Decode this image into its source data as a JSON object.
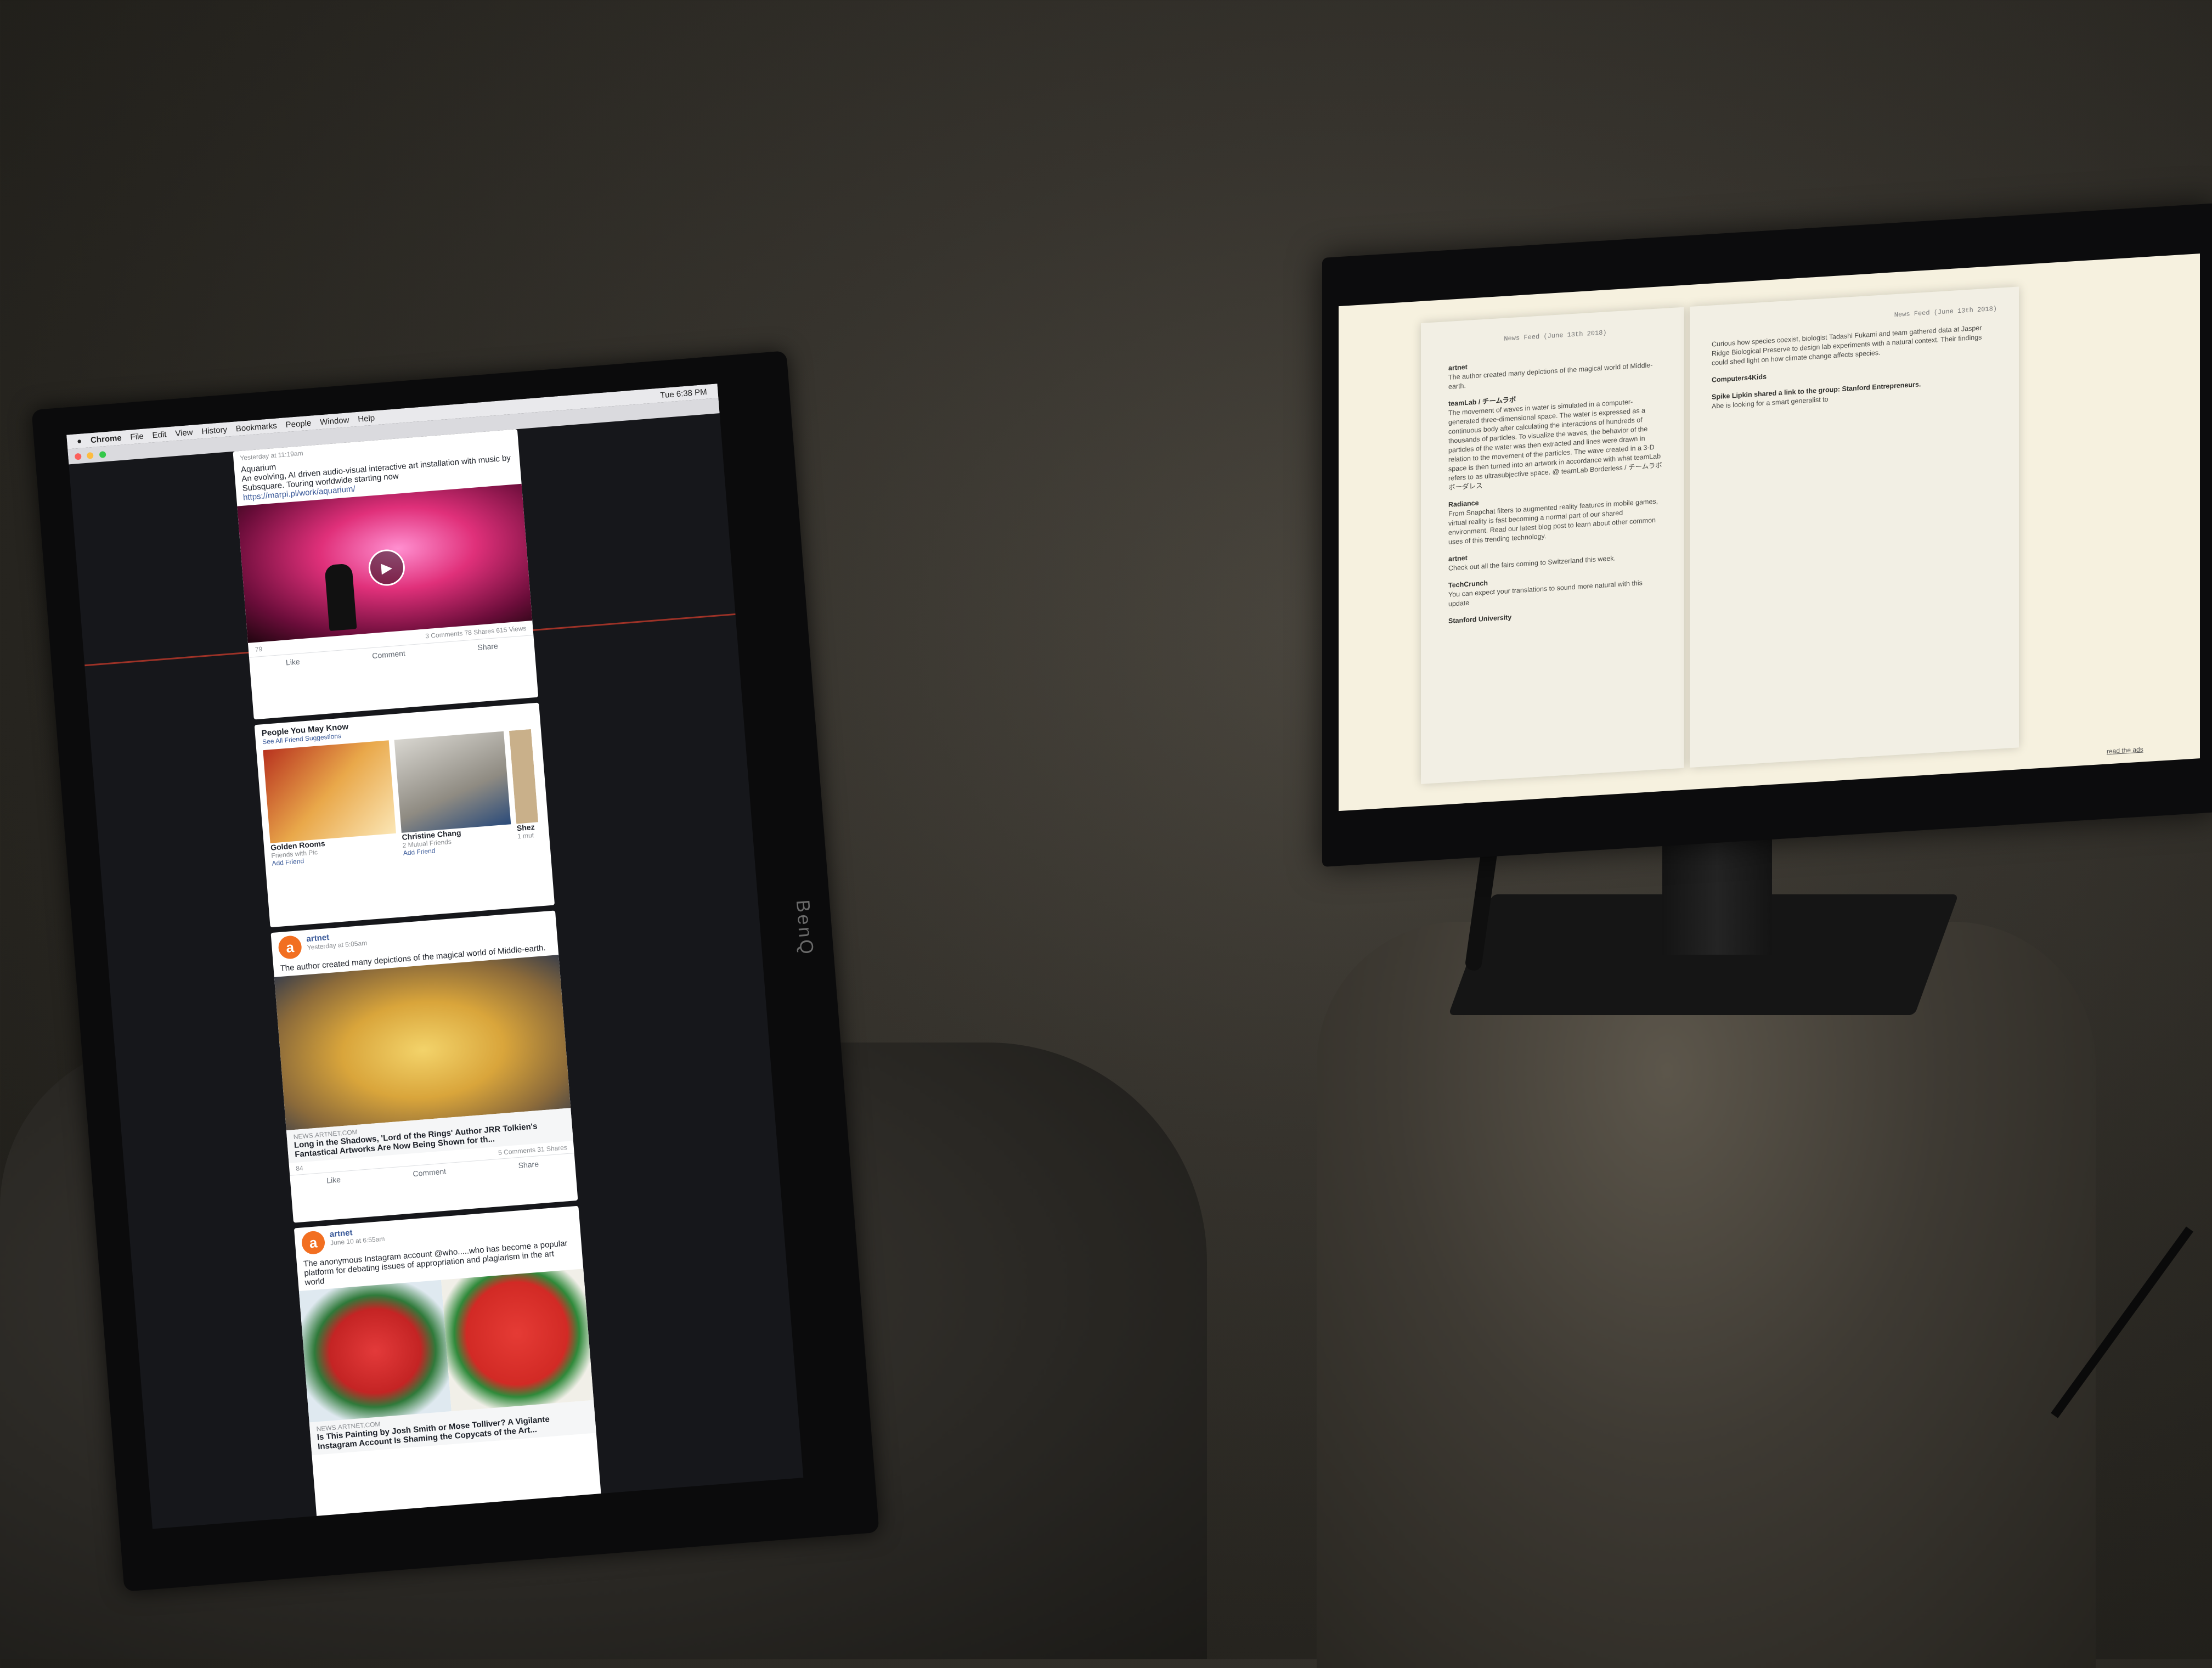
{
  "left_monitor": {
    "brand": "BenQ",
    "menubar": {
      "apple": "",
      "items": [
        "Chrome",
        "File",
        "Edit",
        "View",
        "History",
        "Bookmarks",
        "People",
        "Window",
        "Help"
      ],
      "status": "Tue 6:38 PM"
    },
    "post1": {
      "time": "Yesterday at 11:19am",
      "title": "Aquarium",
      "text": "An evolving, AI driven audio-visual interactive art installation with music by Subsquare. Touring worldwide starting now",
      "link": "https://marpi.pl/work/aquarium/",
      "reactions": "79",
      "stats": "3 Comments  78 Shares  615 Views",
      "like": "Like",
      "comment": "Comment",
      "share": "Share"
    },
    "pymk": {
      "title": "People You May Know",
      "subtitle": "See All Friend Suggestions",
      "people": [
        {
          "name": "Golden Rooms",
          "meta": "Friends with Pic",
          "action": "Add Friend"
        },
        {
          "name": "Christine Chang",
          "meta": "2 Mutual Friends",
          "action": "Add Friend"
        },
        {
          "name": "Shez",
          "meta": "1 mut",
          "action": ""
        }
      ]
    },
    "post2": {
      "author": "artnet",
      "time": "Yesterday at 5:05am",
      "text": "The author created many depictions of the magical world of Middle-earth.",
      "source": "NEWS.ARTNET.COM",
      "headline": "Long in the Shadows, 'Lord of the Rings' Author JRR Tolkien's Fantastical Artworks Are Now Being Shown for th...",
      "reactions": "84",
      "stats": "5 Comments  31 Shares",
      "like": "Like",
      "comment": "Comment",
      "share": "Share"
    },
    "post3": {
      "author": "artnet",
      "time": "June 10 at 6:55am",
      "text": "The anonymous Instagram account @who.....who has become a popular platform for debating issues of appropriation and plagiarism in the art world",
      "source": "NEWS.ARTNET.COM",
      "headline": "Is This Painting by Josh Smith or Mose Tolliver? A Vigilante Instagram Account Is Shaming the Copycats of the Art..."
    }
  },
  "right_monitor": {
    "left_page": {
      "header": "News Feed (June 13th 2018)",
      "entries": [
        {
          "source": "artnet",
          "text": "The author created many depictions of the magical world of Middle-earth."
        },
        {
          "source": "teamLab / チームラボ",
          "text": "The movement of waves in water is simulated in a computer-generated three-dimensional space. The water is expressed as a continuous body after calculating the interactions of hundreds of thousands of particles. To visualize the waves, the behavior of the particles of the water was then extracted and lines were drawn in relation to the movement of the particles. The wave created in a 3-D space is then turned into an artwork in accordance with what teamLab refers to as ultrasubjective space. @ teamLab Borderless / チームラボボーダレス"
        },
        {
          "source": "Radiance",
          "text": "From Snapchat filters to augmented reality features in mobile games, virtual reality is fast becoming a normal part of our shared environment. Read our latest blog post to learn about other common uses of this trending technology."
        },
        {
          "source": "artnet",
          "text": "Check out all the fairs coming to Switzerland this week."
        },
        {
          "source": "TechCrunch",
          "text": "You can expect your translations to sound more natural with this update"
        },
        {
          "source": "Stanford University",
          "text": ""
        }
      ]
    },
    "right_page": {
      "header": "News Feed (June 13th 2018)",
      "intro": "Curious how species coexist, biologist Tadashi Fukami and team gathered data at Jasper Ridge Biological Preserve to design lab experiments with a natural context. Their findings could shed light on how climate change affects species.",
      "entries": [
        {
          "source": "Computers4Kids",
          "text": ""
        },
        {
          "source": "Spike Lipkin shared a link to the group: Stanford Entrepreneurs.",
          "text": "Abe is looking for a smart generalist to"
        }
      ]
    },
    "footer_link": "read the ads"
  },
  "colors": {
    "wall": "#3a3730",
    "fb_blue": "#385898",
    "artnet_orange": "#f26f21",
    "paper": "#f6f1df"
  }
}
